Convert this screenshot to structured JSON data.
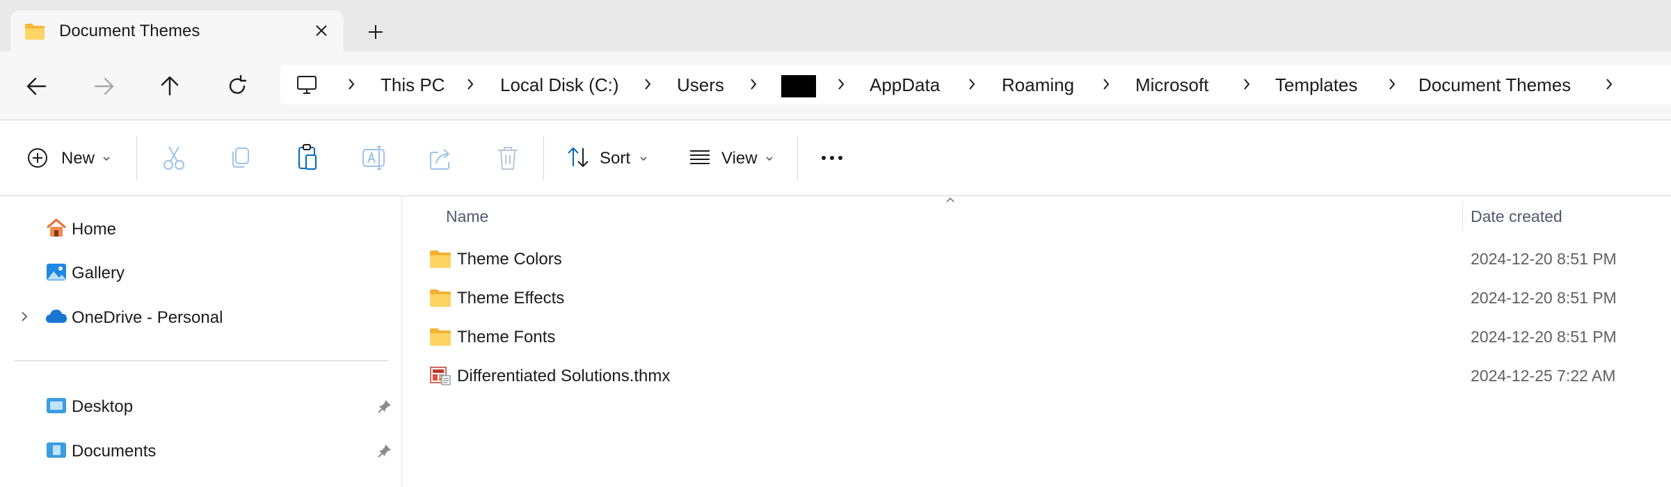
{
  "tab": {
    "title": "Document Themes",
    "close_icon": "close-icon",
    "new_tab_icon": "plus-icon"
  },
  "nav": {
    "back_icon": "arrow-left-icon",
    "forward_icon": "arrow-right-icon",
    "up_icon": "arrow-up-icon",
    "refresh_icon": "refresh-icon"
  },
  "breadcrumb": {
    "root_icon": "monitor-icon",
    "items": [
      "This PC",
      "Local Disk (C:)",
      "Users",
      "",
      "AppData",
      "Roaming",
      "Microsoft",
      "Templates",
      "Document Themes"
    ]
  },
  "toolbar": {
    "new_label": "New",
    "sort_label": "Sort",
    "view_label": "View",
    "more_icon": "more-icon"
  },
  "sidebar": {
    "items": [
      {
        "label": "Home",
        "icon": "home-icon"
      },
      {
        "label": "Gallery",
        "icon": "gallery-icon"
      },
      {
        "label": "OneDrive - Personal",
        "icon": "onedrive-cloud-icon"
      }
    ],
    "pinned": [
      {
        "label": "Desktop",
        "icon": "desktop-folder-icon"
      },
      {
        "label": "Documents",
        "icon": "documents-folder-icon"
      }
    ]
  },
  "list": {
    "columns": {
      "name": "Name",
      "date": "Date created"
    },
    "rows": [
      {
        "name": "Theme Colors",
        "date": "2024-12-20 8:51 PM",
        "icon": "folder-icon"
      },
      {
        "name": "Theme Effects",
        "date": "2024-12-20 8:51 PM",
        "icon": "folder-icon"
      },
      {
        "name": "Theme Fonts",
        "date": "2024-12-20 8:51 PM",
        "icon": "folder-icon"
      },
      {
        "name": "Differentiated Solutions.thmx",
        "date": "2024-12-25 7:22 AM",
        "icon": "theme-file-icon"
      }
    ]
  },
  "colors": {
    "accent": "#0067c0",
    "folder": "#f6c445",
    "tab_strip": "#e9e9e9",
    "nav_bg": "#f7f7f7"
  }
}
